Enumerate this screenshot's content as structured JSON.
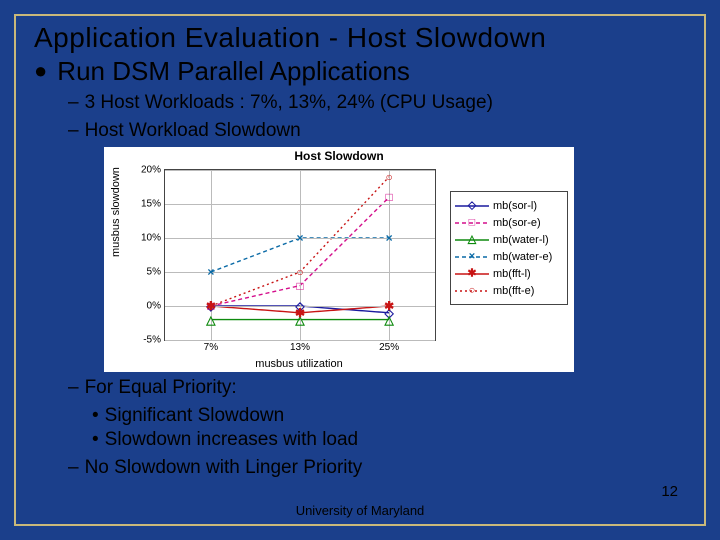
{
  "title": "Application Evaluation - Host Slowdown",
  "subtitle": "Run DSM Parallel Applications",
  "sub_items": {
    "a": "3 Host Workloads : 7%, 13%, 24% (CPU Usage)",
    "b": "Host Workload Slowdown",
    "c": "For Equal Priority:",
    "c1": "Significant Slowdown",
    "c2": "Slowdown increases with load",
    "d": "No Slowdown with Linger Priority"
  },
  "footer": "University of Maryland",
  "page_num": "12",
  "chart_data": {
    "type": "line",
    "title": "Host Slowdown",
    "xlabel": "musbus utilization",
    "ylabel": "musbus slowdown",
    "categories": [
      "7%",
      "13%",
      "25%"
    ],
    "ylim": [
      -5,
      20
    ],
    "yticks": [
      "-5%",
      "0%",
      "5%",
      "10%",
      "15%",
      "20%"
    ],
    "series": [
      {
        "name": "mb(sor-l)",
        "color": "#1a1a9e",
        "dash": "3 0",
        "mark": "◇",
        "values": [
          0,
          0,
          -1
        ]
      },
      {
        "name": "mb(sor-e)",
        "color": "#d40e8c",
        "dash": "4 3",
        "mark": "□",
        "values": [
          0,
          3,
          16
        ]
      },
      {
        "name": "mb(water-l)",
        "color": "#0e8a0e",
        "dash": "3 0",
        "mark": "△",
        "values": [
          -2,
          -2,
          -2
        ]
      },
      {
        "name": "mb(water-e)",
        "color": "#0a6aa6",
        "dash": "4 3",
        "mark": "×",
        "values": [
          5,
          10,
          10
        ]
      },
      {
        "name": "mb(fft-l)",
        "color": "#c81414",
        "dash": "3 0",
        "mark": "✱",
        "values": [
          0,
          -1,
          0
        ]
      },
      {
        "name": "mb(fft-e)",
        "color": "#c81414",
        "dash": "2 3",
        "mark": "○",
        "values": [
          0,
          5,
          19
        ]
      }
    ]
  }
}
